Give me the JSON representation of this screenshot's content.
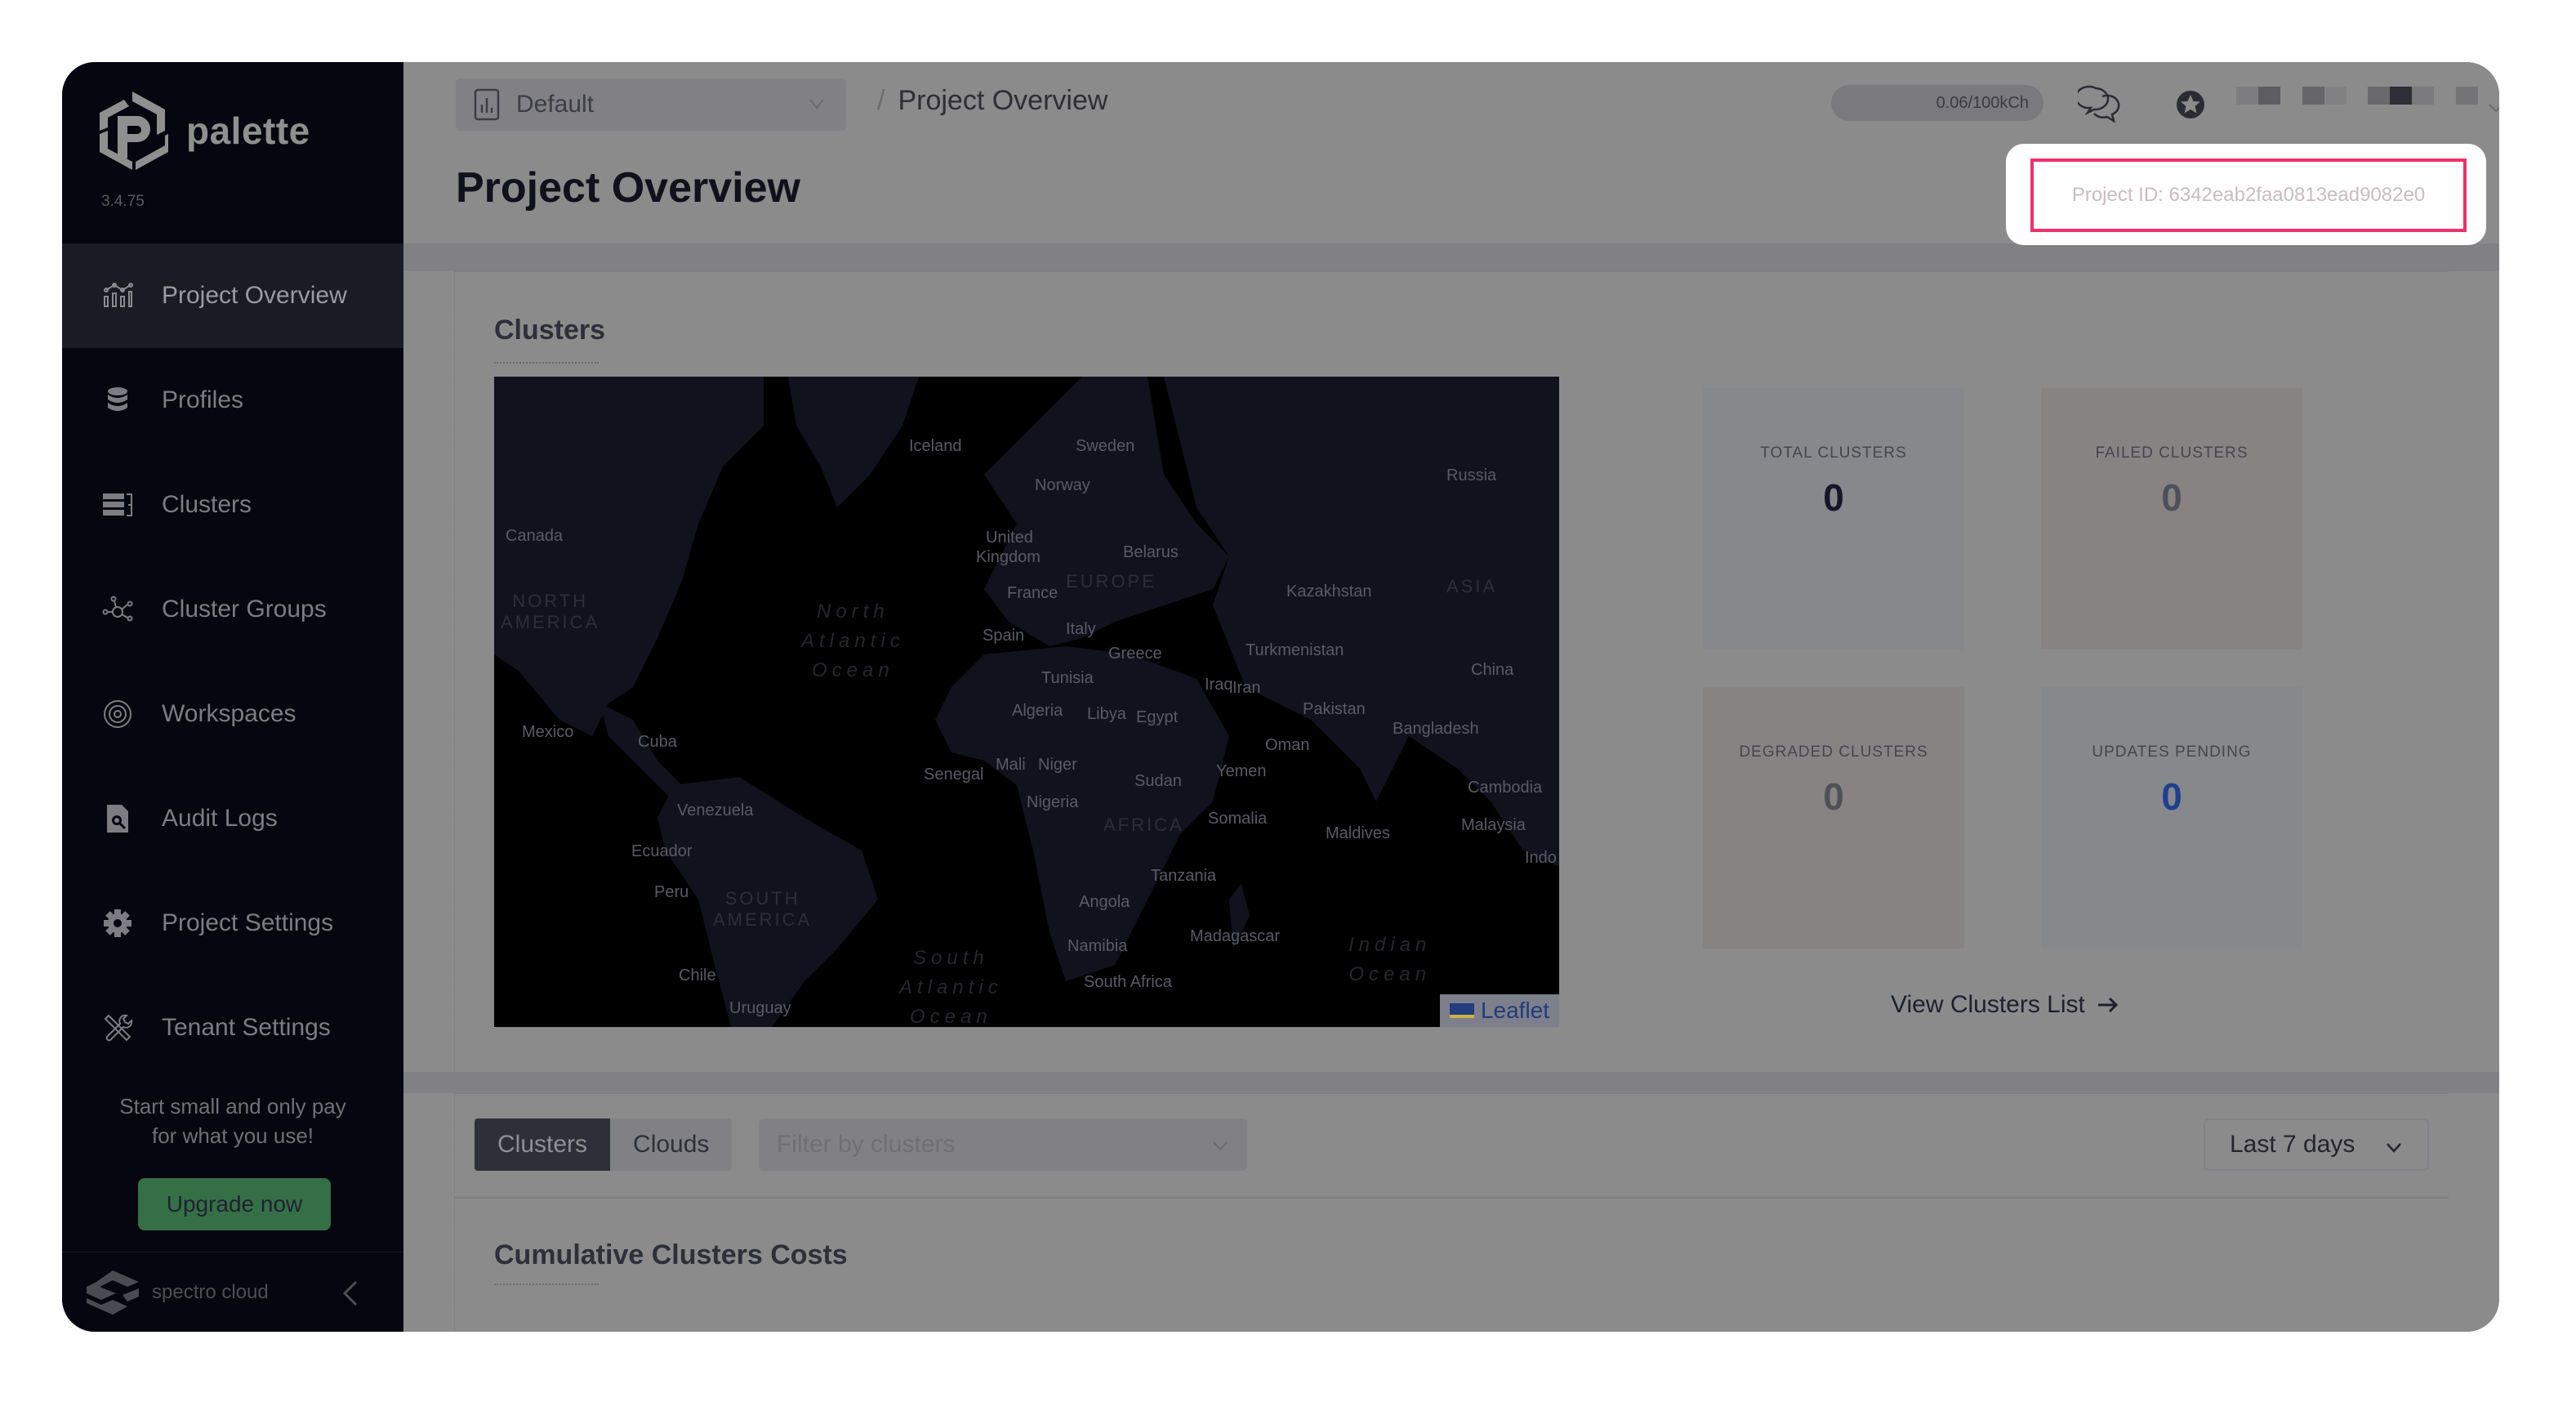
{
  "sidebar": {
    "brand": "palette",
    "version": "3.4.75",
    "items": [
      {
        "label": "Project Overview",
        "icon": "chart-icon",
        "active": true
      },
      {
        "label": "Profiles",
        "icon": "database-stack-icon",
        "active": false
      },
      {
        "label": "Clusters",
        "icon": "server-rack-icon",
        "active": false
      },
      {
        "label": "Cluster Groups",
        "icon": "network-nodes-icon",
        "active": false
      },
      {
        "label": "Workspaces",
        "icon": "concentric-circles-icon",
        "active": false
      },
      {
        "label": "Audit Logs",
        "icon": "file-search-icon",
        "active": false
      },
      {
        "label": "Project Settings",
        "icon": "gear-icon",
        "active": false
      },
      {
        "label": "Tenant Settings",
        "icon": "tools-icon",
        "active": false
      }
    ],
    "promo_line1": "Start small and only pay",
    "promo_line2": "for what you use!",
    "upgrade_label": "Upgrade now",
    "footer_brand": "spectro cloud"
  },
  "topbar": {
    "project_selector": "Default",
    "breadcrumb_sep": "/",
    "breadcrumb_current": "Project Overview",
    "usage": "0.06/100kCh"
  },
  "page": {
    "title": "Project Overview",
    "project_id": "Project ID: 6342eab2faa0813ead9082e0"
  },
  "clusters": {
    "title": "Clusters",
    "stats": [
      {
        "label": "TOTAL CLUSTERS",
        "value": "0",
        "color": "#151726",
        "bg": "#87888c"
      },
      {
        "label": "FAILED CLUSTERS",
        "value": "0",
        "color": "#4f5159",
        "bg": "#878383"
      },
      {
        "label": "DEGRADED CLUSTERS",
        "value": "0",
        "color": "#4f5159",
        "bg": "#878383"
      },
      {
        "label": "UPDATES PENDING",
        "value": "0",
        "color": "#1f3f8f",
        "bg": "#87888c"
      }
    ],
    "view_list": "View Clusters List",
    "map_attribution": "Leaflet",
    "map_labels": {
      "countries": [
        "Iceland",
        "Sweden",
        "Norway",
        "Russia",
        "Canada",
        "United",
        "Kingdom",
        "Belarus",
        "France",
        "Kazakhstan",
        "Spain",
        "Italy",
        "Greece",
        "Turkmenistan",
        "China",
        "Tunisia",
        "Iraq",
        "Iran",
        "Algeria",
        "Libya",
        "Egypt",
        "Pakistan",
        "Mexico",
        "Cuba",
        "Bangladesh",
        "Oman",
        "Senegal",
        "Mali",
        "Niger",
        "Sudan",
        "Yemen",
        "Cambodia",
        "Venezuela",
        "Nigeria",
        "Somalia",
        "Maldives",
        "Malaysia",
        "Ecuador",
        "Tanzania",
        "Peru",
        "Angola",
        "Madagascar",
        "Namibia",
        "Chile",
        "South Africa",
        "Uruguay",
        "Indo"
      ],
      "regions": [
        "NORTH AMERICA",
        "EUROPE",
        "ASIA",
        "AFRICA",
        "SOUTH AMERICA"
      ],
      "oceans": [
        "North Atlantic Ocean",
        "South Atlantic Ocean",
        "Indian Ocean"
      ]
    }
  },
  "costs": {
    "tabs": [
      {
        "label": "Clusters",
        "active": true
      },
      {
        "label": "Clouds",
        "active": false
      }
    ],
    "filter_placeholder": "Filter by clusters",
    "range": "Last 7 days",
    "title": "Cumulative Clusters Costs"
  },
  "help": {
    "label": "?"
  }
}
